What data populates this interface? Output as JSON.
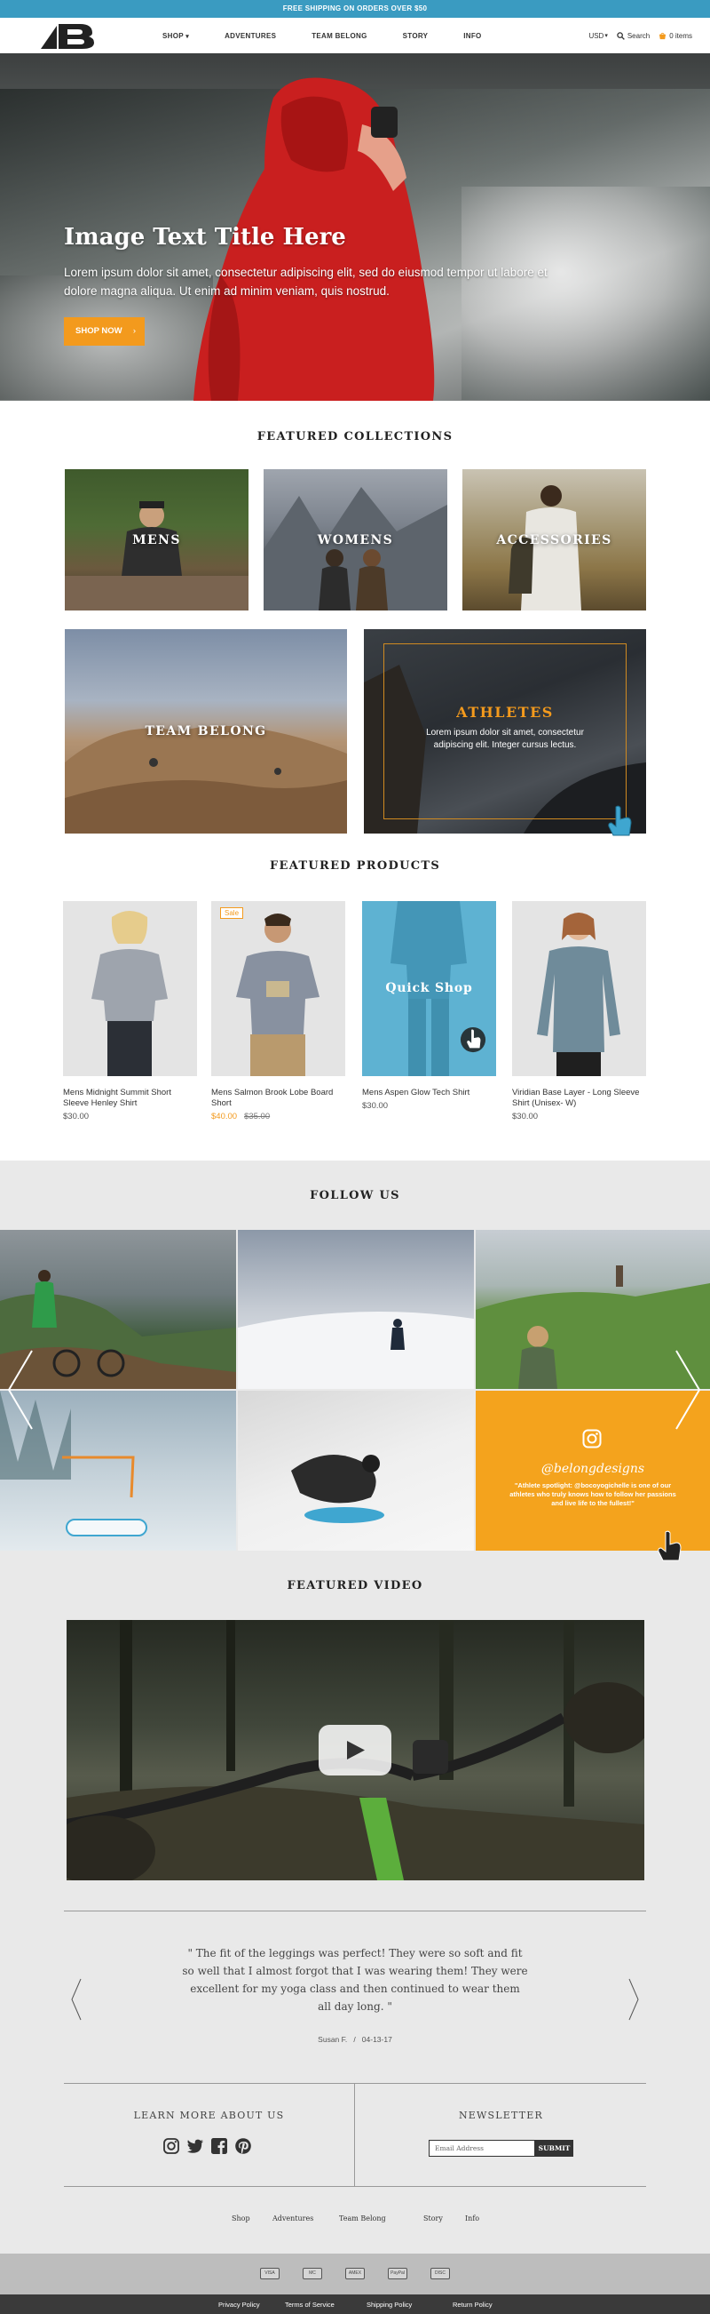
{
  "announcement": "FREE SHIPPING ON ORDERS OVER $50",
  "header": {
    "logo_text": "MB",
    "nav": [
      "SHOP",
      "ADVENTURES",
      "TEAM BELONG",
      "STORY",
      "INFO"
    ],
    "currency": "USD",
    "search_label": "Search",
    "cart_label": "0 items"
  },
  "hero": {
    "title": "Image Text Title Here",
    "text": "Lorem ipsum dolor sit amet, consectetur adipiscing elit, sed do eiusmod tempor ut labore et dolore magna aliqua. Ut enim ad minim veniam, quis nostrud.",
    "button": "SHOP NOW",
    "button_icon": "chevron-right"
  },
  "featured_collections": {
    "title": "FEATURED COLLECTIONS",
    "tiles": [
      "MENS",
      "WOMENS",
      "ACCESSORIES",
      "TEAM BELONG"
    ],
    "athletes": {
      "title": "ATHLETES",
      "text": "Lorem ipsum dolor sit amet, consectetur adipiscing elit. Integer cursus lectus."
    }
  },
  "featured_products": {
    "title": "FEATURED PRODUCTS",
    "quick_shop": "Quick Shop",
    "sale_badge": "Sale",
    "products": [
      {
        "name": "Mens Midnight Summit Short Sleeve Henley Shirt",
        "price": "$30.00"
      },
      {
        "name": "Mens Salmon Brook Lobe Board Short",
        "price": "$40.00",
        "compare": "$35.00"
      },
      {
        "name": "Mens Aspen Glow Tech Shirt",
        "price": "$30.00"
      },
      {
        "name": "Viridian Base Layer - Long Sleeve Shirt (Unisex- W)",
        "price": "$30.00"
      }
    ]
  },
  "follow": {
    "title": "FOLLOW US",
    "handle": "@belongdesigns",
    "caption": "\"Athlete spotlight: @bocoyogichelle is one of our athletes who truly knows how to follow her passions and live life to the fullest!\""
  },
  "video": {
    "title": "FEATURED VIDEO"
  },
  "testimonial": {
    "quote": "\" The fit of the leggings was perfect! They were so soft and fit so well that I almost forgot that I was wearing them! They were excellent for my yoga class and then continued to wear them all day long. \"",
    "author": "Susan F.   /   04-13-17"
  },
  "learn_more": {
    "title": "LEARN MORE ABOUT US",
    "icons": [
      "instagram-icon",
      "twitter-icon",
      "facebook-icon",
      "pinterest-icon"
    ]
  },
  "newsletter": {
    "title": "NEWSLETTER",
    "placeholder": "Email Address",
    "button": "SUBMIT"
  },
  "footer": {
    "nav": [
      "Shop",
      "Adventures",
      "Team Belong",
      "Story",
      "Info"
    ],
    "payments": [
      "VISA",
      "MC",
      "AMEX",
      "PayPal",
      "DISC"
    ],
    "legal": [
      "Privacy Policy",
      "Terms of Service",
      "Shipping Policy",
      "Return Policy"
    ]
  },
  "colors": {
    "accent": "#f39a1d",
    "announce": "#3a9bc1",
    "quick_shop": "#3ea3cb",
    "dark": "#3a3a3a"
  }
}
